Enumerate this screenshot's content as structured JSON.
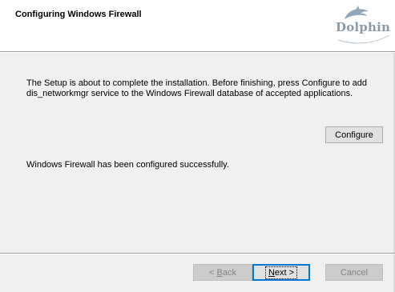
{
  "header": {
    "title": "Configuring Windows Firewall",
    "logo_text": "Dolphin"
  },
  "main": {
    "description": "The Setup is about to complete the installation. Before finishing, press Configure to add\ndis_networkmgr service to the Windows Firewall database of accepted applications.",
    "configure_label": "Configure",
    "status": "Windows Firewall has been configured successfully."
  },
  "footer": {
    "back_label": "< Back",
    "next_label": "Next >",
    "cancel_label": "Cancel"
  },
  "colors": {
    "logo": "#8a9aa6",
    "default_button_border": "#0078d7",
    "dialog_background": "#f0f0f0"
  },
  "icons": {
    "logo": "dolphin-icon"
  }
}
